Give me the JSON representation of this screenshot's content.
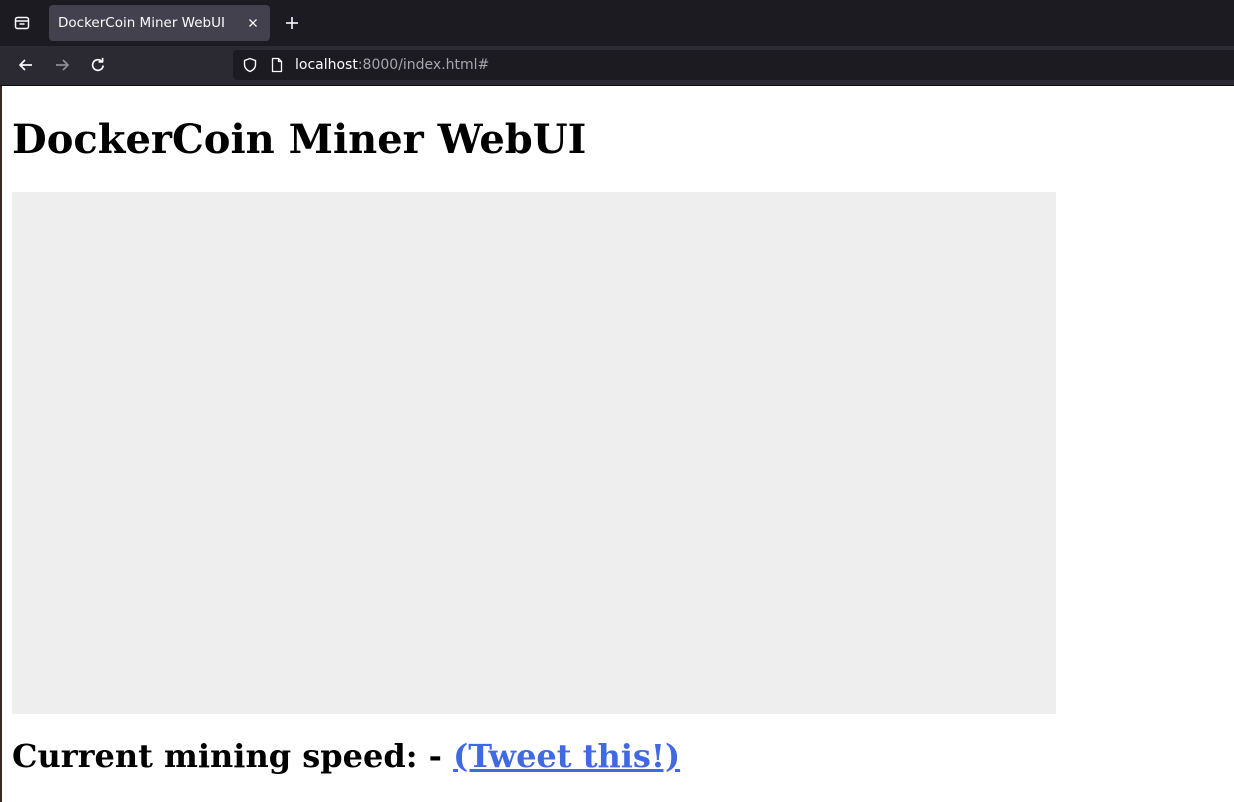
{
  "browser": {
    "tab": {
      "title": "DockerCoin Miner WebUI"
    },
    "url": {
      "host": "localhost",
      "rest": ":8000/index.html#"
    },
    "colors": {
      "tab_strip": "#1c1b22",
      "toolbar": "#2b2a33",
      "active_tab": "#42414d",
      "icon": "#fbfbfe",
      "icon_disabled": "#8f8f9d"
    }
  },
  "page": {
    "heading": "DockerCoin Miner WebUI",
    "speed_label": "Current mining speed:",
    "speed_value": "-",
    "tweet_link": "(Tweet this!)",
    "colors": {
      "graph_background": "#eeeeee",
      "link": "#4169e1"
    }
  }
}
